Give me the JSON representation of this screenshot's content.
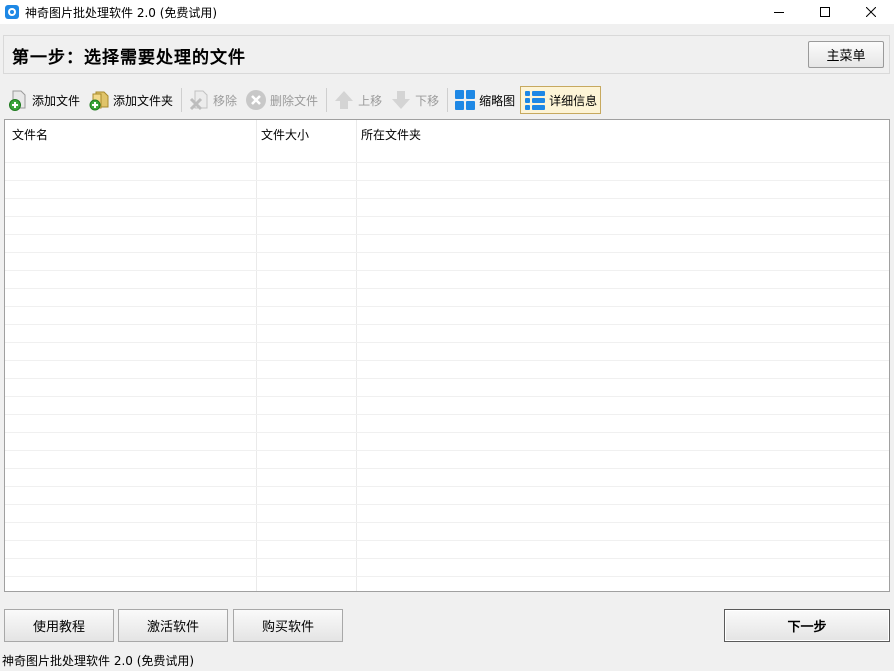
{
  "window": {
    "title": "神奇图片批处理软件 2.0 (免费试用)"
  },
  "step": {
    "title": "第一步：选择需要处理的文件",
    "main_menu_label": "主菜单"
  },
  "toolbar": {
    "add_file": "添加文件",
    "add_folder": "添加文件夹",
    "remove": "移除",
    "delete_file": "删除文件",
    "move_up": "上移",
    "move_down": "下移",
    "thumbnail": "缩略图",
    "details": "详细信息"
  },
  "filelist": {
    "columns": [
      "文件名",
      "文件大小",
      "所在文件夹"
    ],
    "rows": []
  },
  "bottom": {
    "tutorial": "使用教程",
    "activate": "激活软件",
    "buy": "购买软件",
    "next": "下一步"
  },
  "status": {
    "text": "神奇图片批处理软件 2.0 (免费试用)"
  },
  "colors": {
    "accent": "#1e88e5",
    "selected_bg": "#fdf4d6",
    "selected_border": "#c7a95f"
  }
}
